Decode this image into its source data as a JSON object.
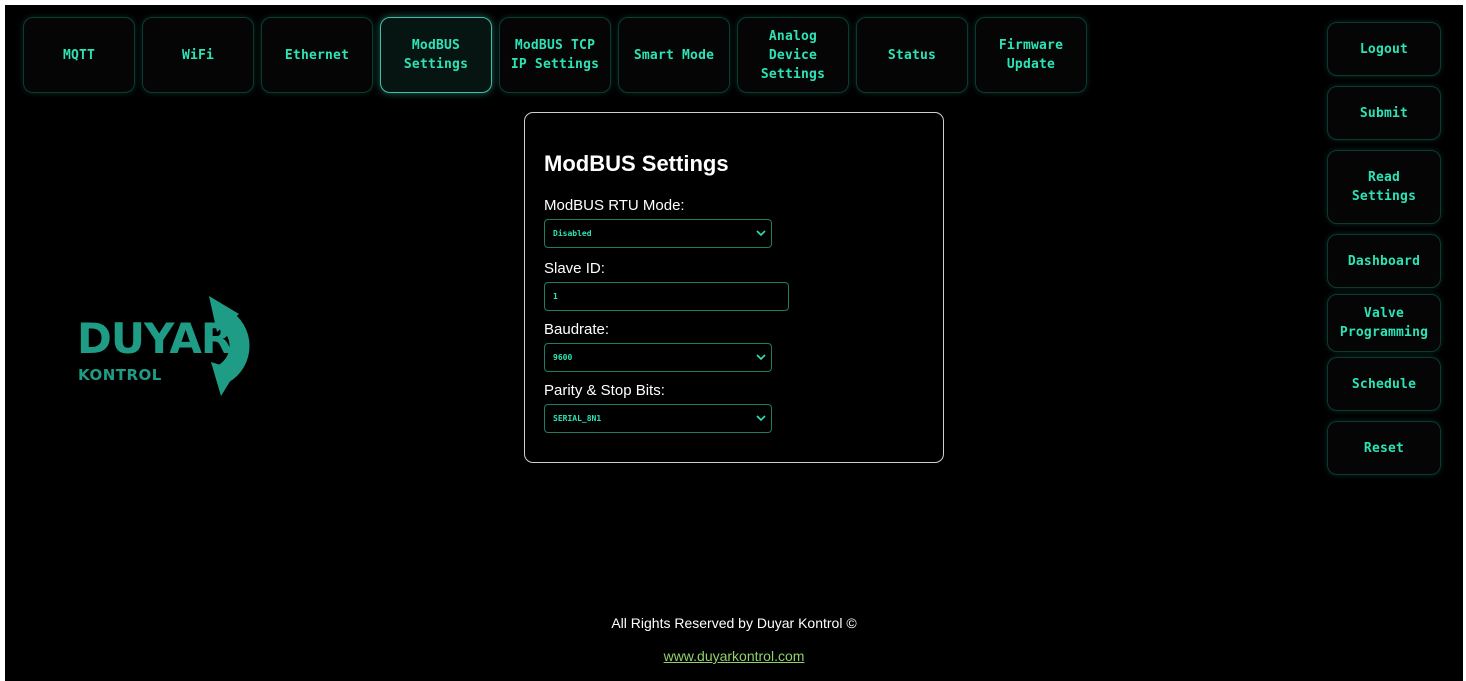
{
  "nav": {
    "tabs": [
      {
        "label": "MQTT",
        "active": false
      },
      {
        "label": "WiFi",
        "active": false
      },
      {
        "label": "Ethernet",
        "active": false
      },
      {
        "label": "ModBUS\nSettings",
        "active": true
      },
      {
        "label": "ModBUS TCP\nIP Settings",
        "active": false
      },
      {
        "label": "Smart Mode",
        "active": false
      },
      {
        "label": "Analog\nDevice\nSettings",
        "active": false
      },
      {
        "label": "Status",
        "active": false
      },
      {
        "label": "Firmware\nUpdate",
        "active": false
      }
    ]
  },
  "side": {
    "buttons": [
      {
        "label": "Logout"
      },
      {
        "label": "Submit"
      },
      {
        "label": "Read\nSettings"
      },
      {
        "label": "Dashboard"
      },
      {
        "label": "Valve\nProgramming"
      },
      {
        "label": "Schedule"
      },
      {
        "label": "Reset"
      }
    ]
  },
  "logo": {
    "word": "DUYAR",
    "sub": "KONTROL"
  },
  "form": {
    "title": "ModBUS Settings",
    "rtu_mode": {
      "label": "ModBUS RTU Mode:",
      "value": "Disabled"
    },
    "slave_id": {
      "label": "Slave ID:",
      "value": "1"
    },
    "baudrate": {
      "label": "Baudrate:",
      "value": "9600"
    },
    "parity": {
      "label": "Parity & Stop Bits:",
      "value": "SERIAL_8N1"
    }
  },
  "footer": {
    "copyright": "All Rights Reserved by Duyar Kontrol ©",
    "link": "www.duyarkontrol.com"
  },
  "colors": {
    "accent": "#2de3b6",
    "brand": "#1f9c86",
    "link": "#8fd16a",
    "background": "#000000"
  }
}
